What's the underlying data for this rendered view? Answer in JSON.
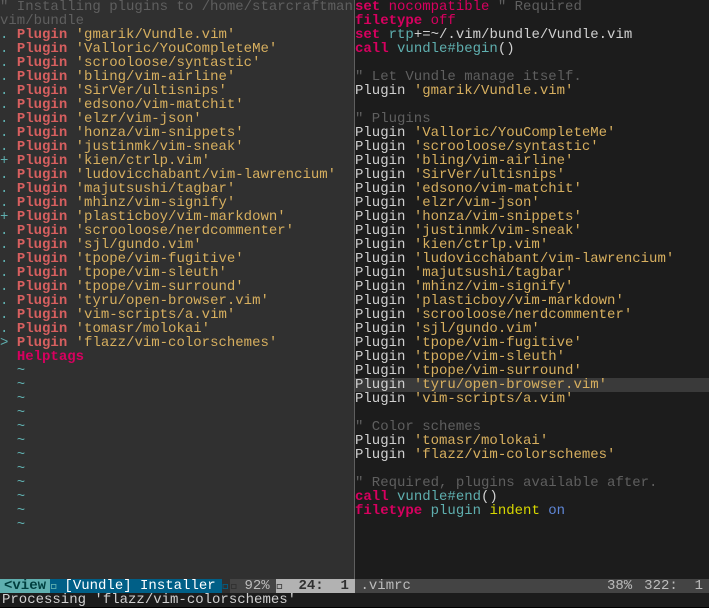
{
  "left": {
    "header_comment": "\" Installing plugins to /home/starcraftman/.\nvim/bundle",
    "plugins": [
      {
        "g": ". ",
        "name": "gmarik/Vundle.vim"
      },
      {
        "g": ". ",
        "name": "Valloric/YouCompleteMe"
      },
      {
        "g": ". ",
        "name": "scrooloose/syntastic"
      },
      {
        "g": ". ",
        "name": "bling/vim-airline"
      },
      {
        "g": ". ",
        "name": "SirVer/ultisnips"
      },
      {
        "g": ". ",
        "name": "edsono/vim-matchit"
      },
      {
        "g": ". ",
        "name": "elzr/vim-json"
      },
      {
        "g": ". ",
        "name": "honza/vim-snippets"
      },
      {
        "g": ". ",
        "name": "justinmk/vim-sneak"
      },
      {
        "g": "+ ",
        "name": "kien/ctrlp.vim"
      },
      {
        "g": ". ",
        "name": "ludovicchabant/vim-lawrencium"
      },
      {
        "g": ". ",
        "name": "majutsushi/tagbar"
      },
      {
        "g": ". ",
        "name": "mhinz/vim-signify"
      },
      {
        "g": "+ ",
        "name": "plasticboy/vim-markdown"
      },
      {
        "g": ". ",
        "name": "scrooloose/nerdcommenter"
      },
      {
        "g": ". ",
        "name": "sjl/gundo.vim"
      },
      {
        "g": ". ",
        "name": "tpope/vim-fugitive"
      },
      {
        "g": ". ",
        "name": "tpope/vim-sleuth"
      },
      {
        "g": ". ",
        "name": "tpope/vim-surround"
      },
      {
        "g": ". ",
        "name": "tyru/open-browser.vim"
      },
      {
        "g": ". ",
        "name": "vim-scripts/a.vim"
      },
      {
        "g": ". ",
        "name": "tomasr/molokai"
      },
      {
        "g": "> ",
        "name": "flazz/vim-colorschemes"
      }
    ],
    "helptags": "Helptags",
    "tildes": [
      "~",
      "~",
      "~",
      "~",
      "~",
      "~",
      "~",
      "~",
      "~",
      "~",
      "~",
      "~"
    ]
  },
  "right": [
    {
      "t": "setno",
      "set": "set ",
      "key": "nocompatible",
      "rest": " \" Required"
    },
    {
      "t": "ft",
      "kw": "filetype ",
      "val": "off"
    },
    {
      "t": "setrtp",
      "set": "set ",
      "key": "rtp",
      "rest": "+=~/.vim/bundle/Vundle.vim"
    },
    {
      "t": "call",
      "kw": "call ",
      "fn": "vundle#begin",
      "rest": "()"
    },
    {
      "t": "blank"
    },
    {
      "t": "comment",
      "text": "\" Let Vundle manage itself."
    },
    {
      "t": "plugin",
      "name": "gmarik/Vundle.vim"
    },
    {
      "t": "blank"
    },
    {
      "t": "comment",
      "text": "\" Plugins"
    },
    {
      "t": "plugin",
      "name": "Valloric/YouCompleteMe"
    },
    {
      "t": "plugin",
      "name": "scrooloose/syntastic"
    },
    {
      "t": "plugin",
      "name": "bling/vim-airline"
    },
    {
      "t": "plugin",
      "name": "SirVer/ultisnips"
    },
    {
      "t": "plugin",
      "name": "edsono/vim-matchit"
    },
    {
      "t": "plugin",
      "name": "elzr/vim-json"
    },
    {
      "t": "plugin",
      "name": "honza/vim-snippets"
    },
    {
      "t": "plugin",
      "name": "justinmk/vim-sneak"
    },
    {
      "t": "plugin",
      "name": "kien/ctrlp.vim"
    },
    {
      "t": "plugin",
      "name": "ludovicchabant/vim-lawrencium"
    },
    {
      "t": "plugin",
      "name": "majutsushi/tagbar"
    },
    {
      "t": "plugin",
      "name": "mhinz/vim-signify"
    },
    {
      "t": "plugin",
      "name": "plasticboy/vim-markdown"
    },
    {
      "t": "plugin",
      "name": "scrooloose/nerdcommenter"
    },
    {
      "t": "plugin",
      "name": "sjl/gundo.vim"
    },
    {
      "t": "plugin",
      "name": "tpope/vim-fugitive"
    },
    {
      "t": "plugin",
      "name": "tpope/vim-sleuth"
    },
    {
      "t": "plugin",
      "name": "tpope/vim-surround"
    },
    {
      "t": "plugin",
      "name": "tyru/open-browser.vim",
      "hl": true
    },
    {
      "t": "plugin",
      "name": "vim-scripts/a.vim"
    },
    {
      "t": "blank"
    },
    {
      "t": "comment",
      "text": "\" Color schemes"
    },
    {
      "t": "plugin",
      "name": "tomasr/molokai"
    },
    {
      "t": "plugin",
      "name": "flazz/vim-colorschemes"
    },
    {
      "t": "blank"
    },
    {
      "t": "comment",
      "text": "\" Required, plugins available after."
    },
    {
      "t": "call",
      "kw": "call ",
      "fn": "vundle#end",
      "rest": "()"
    },
    {
      "t": "ftpi",
      "kw": "filetype ",
      "p": "plugin ",
      "i": "indent ",
      "o": "on"
    }
  ],
  "status": {
    "left": {
      "mode": "<view",
      "title": "[Vundle] Installer",
      "pct": "92%",
      "line": " 24:",
      "col": "  1"
    },
    "right": {
      "file": ".vimrc",
      "pct": "38%",
      "line": "322:",
      "col": "  1"
    }
  },
  "cmdline": "Processing 'flazz/vim-colorschemes'"
}
